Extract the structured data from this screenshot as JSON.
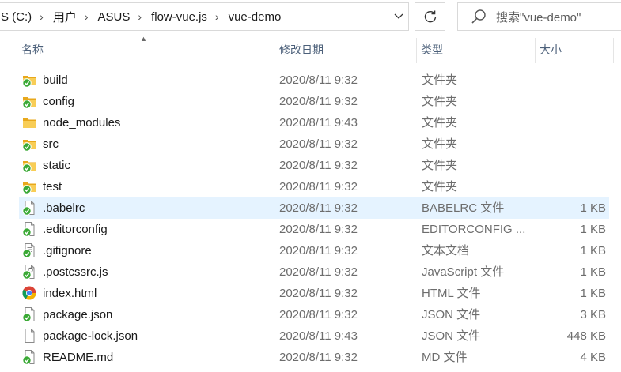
{
  "address_bar": {
    "crumbs": [
      "S (C:)",
      "用户",
      "ASUS",
      "flow-vue.js",
      "vue-demo"
    ]
  },
  "search": {
    "placeholder": "搜索\"vue-demo\""
  },
  "columns": {
    "name": "名称",
    "date": "修改日期",
    "type": "类型",
    "size": "大小"
  },
  "files": [
    {
      "name": "build",
      "date": "2020/8/11 9:32",
      "type": "文件夹",
      "size": "",
      "icon": "folder-synced-icon"
    },
    {
      "name": "config",
      "date": "2020/8/11 9:32",
      "type": "文件夹",
      "size": "",
      "icon": "folder-synced-icon"
    },
    {
      "name": "node_modules",
      "date": "2020/8/11 9:43",
      "type": "文件夹",
      "size": "",
      "icon": "folder-icon"
    },
    {
      "name": "src",
      "date": "2020/8/11 9:32",
      "type": "文件夹",
      "size": "",
      "icon": "folder-synced-icon"
    },
    {
      "name": "static",
      "date": "2020/8/11 9:32",
      "type": "文件夹",
      "size": "",
      "icon": "folder-synced-icon"
    },
    {
      "name": "test",
      "date": "2020/8/11 9:32",
      "type": "文件夹",
      "size": "",
      "icon": "folder-synced-icon"
    },
    {
      "name": ".babelrc",
      "date": "2020/8/11 9:32",
      "type": "BABELRC 文件",
      "size": "1 KB",
      "icon": "file-synced-icon"
    },
    {
      "name": ".editorconfig",
      "date": "2020/8/11 9:32",
      "type": "EDITORCONFIG ...",
      "size": "1 KB",
      "icon": "file-synced-icon"
    },
    {
      "name": ".gitignore",
      "date": "2020/8/11 9:32",
      "type": "文本文档",
      "size": "1 KB",
      "icon": "text-file-synced-icon"
    },
    {
      "name": ".postcssrc.js",
      "date": "2020/8/11 9:32",
      "type": "JavaScript 文件",
      "size": "1 KB",
      "icon": "script-file-synced-icon"
    },
    {
      "name": "index.html",
      "date": "2020/8/11 9:32",
      "type": "HTML 文件",
      "size": "1 KB",
      "icon": "chrome-html-icon"
    },
    {
      "name": "package.json",
      "date": "2020/8/11 9:32",
      "type": "JSON 文件",
      "size": "3 KB",
      "icon": "file-synced-icon"
    },
    {
      "name": "package-lock.json",
      "date": "2020/8/11 9:43",
      "type": "JSON 文件",
      "size": "448 KB",
      "icon": "file-icon"
    },
    {
      "name": "README.md",
      "date": "2020/8/11 9:32",
      "type": "MD 文件",
      "size": "4 KB",
      "icon": "file-synced-icon"
    }
  ],
  "selected_row": 6,
  "colors": {
    "folder": "#f6c33c",
    "sync_green": "#3aa935",
    "selection": "#e5f3ff",
    "header_text": "#4c607a"
  }
}
